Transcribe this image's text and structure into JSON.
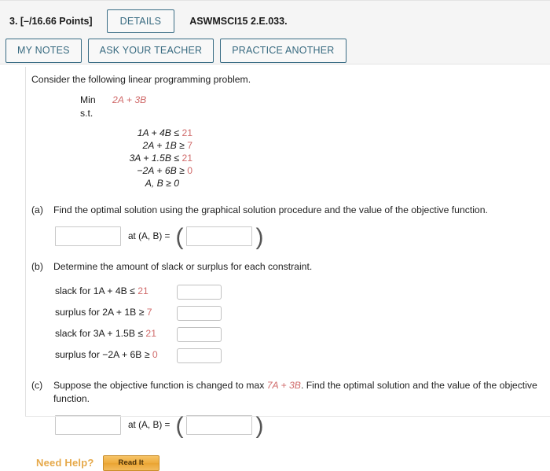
{
  "header": {
    "points_label": "3.  [–/16.66 Points]",
    "details_button": "DETAILS",
    "assignment_code": "ASWMSCI15 2.E.033.",
    "my_notes_button": "MY NOTES",
    "ask_your_teacher_button": "ASK YOUR TEACHER",
    "practice_another_button": "PRACTICE ANOTHER"
  },
  "question": {
    "intro": "Consider the following linear programming problem.",
    "lp": {
      "min_label": "Min",
      "objective": "2A + 3B",
      "st_label": "s.t.",
      "constraints": [
        {
          "lhs": "1A + 4B",
          "op": "≤",
          "rhs": "21"
        },
        {
          "lhs": "2A + 1B",
          "op": "≥",
          "rhs": "7"
        },
        {
          "lhs": "3A + 1.5B",
          "op": "≤",
          "rhs": "21"
        },
        {
          "lhs": "−2A + 6B",
          "op": "≥",
          "rhs": "0"
        }
      ],
      "nonnegativity": "A, B ≥ 0"
    },
    "parts": [
      {
        "letter": "(a)",
        "prompt": "Find the optimal solution using the graphical solution procedure and the value of the objective function.",
        "prompt_accent": "",
        "prompt_tail": "",
        "at_label": "at (A, B) =",
        "value_input": "",
        "point_input": ""
      },
      {
        "letter": "(b)",
        "prompt": "Determine the amount of slack or surplus for each constraint.",
        "rows": [
          {
            "label": "slack for 1A + 4B ≤ ",
            "rhs": "21",
            "value": ""
          },
          {
            "label": "surplus for 2A + 1B ≥ ",
            "rhs": "7",
            "value": ""
          },
          {
            "label": "slack for 3A + 1.5B ≤ ",
            "rhs": "21",
            "value": ""
          },
          {
            "label": "surplus for −2A + 6B ≥ ",
            "rhs": "0",
            "value": ""
          }
        ]
      },
      {
        "letter": "(c)",
        "prompt_head": "Suppose the objective function is changed to max ",
        "prompt_accent": "7A + 3B",
        "prompt_tail": ". Find the optimal solution and the value of the objective function.",
        "at_label": "at (A, B) =",
        "value_input": "",
        "point_input": ""
      }
    ]
  },
  "footer": {
    "need_help_label": "Need Help?",
    "read_it_button": "Read It"
  },
  "colors": {
    "accent_red": "#d06a6a",
    "button_blue": "#36697f",
    "need_help_orange": "#e6a94a"
  }
}
